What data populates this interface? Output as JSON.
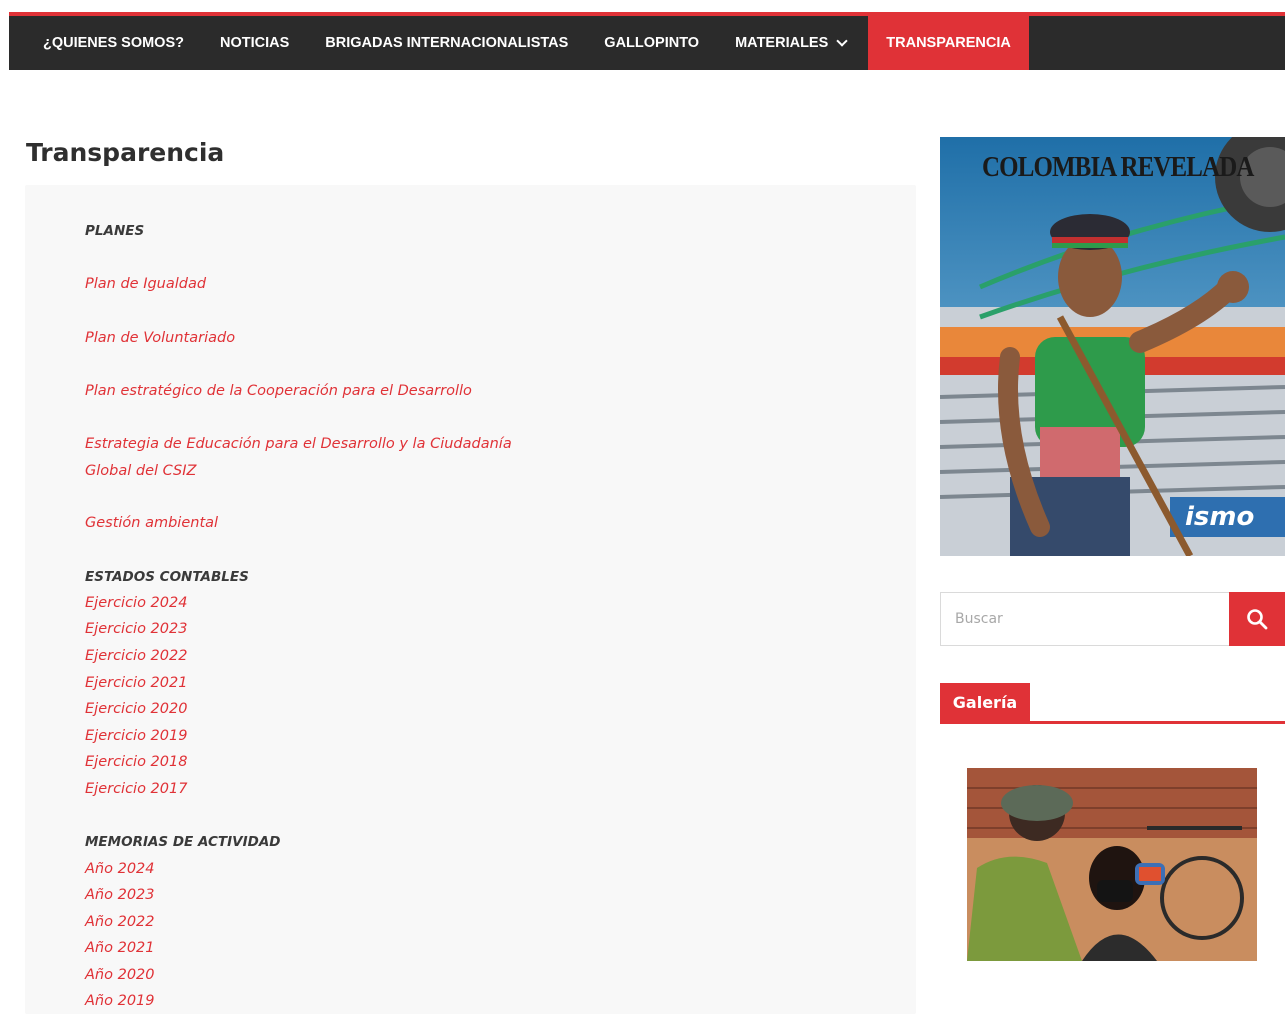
{
  "nav": {
    "items": [
      {
        "label": "¿QUIENES SOMOS?"
      },
      {
        "label": "NOTICIAS"
      },
      {
        "label": "BRIGADAS INTERNACIONALISTAS"
      },
      {
        "label": "GALLOPINTO"
      },
      {
        "label": "MATERIALES",
        "has_dropdown": true
      },
      {
        "label": "TRANSPARENCIA",
        "active": true
      }
    ]
  },
  "page": {
    "title": "Transparencia"
  },
  "content": {
    "planes_heading": "PLANES",
    "planes": [
      "Plan de Igualdad",
      "Plan de Voluntariado",
      "Plan estratégico de la Cooperación para el Desarrollo",
      "Estrategia de Educación para el Desarrollo y la Ciudadanía",
      "Global del CSIZ",
      "Gestión ambiental"
    ],
    "estados_heading": "ESTADOS CONTABLES",
    "estados": [
      "Ejercicio 2024",
      "Ejercicio 2023",
      "Ejercicio 2022",
      "Ejercicio 2021",
      "Ejercicio 2020",
      "Ejercicio 2019",
      "Ejercicio 2018",
      "Ejercicio 2017"
    ],
    "memorias_heading": "MEMORIAS DE ACTIVIDAD",
    "memorias": [
      "Año 2024",
      "Año 2023",
      "Año 2022",
      "Año 2021",
      "Año 2020",
      "Año 2019"
    ]
  },
  "sidebar": {
    "hero_title": "COLOMBIA REVELADA",
    "search_placeholder": "Buscar",
    "gallery_title": "Galería"
  },
  "colors": {
    "accent": "#e03237",
    "nav_bg": "#2b2b2b",
    "content_bg": "#f8f8f8"
  },
  "icons": {
    "search": "search-icon",
    "dropdown": "chevron-down-icon"
  }
}
